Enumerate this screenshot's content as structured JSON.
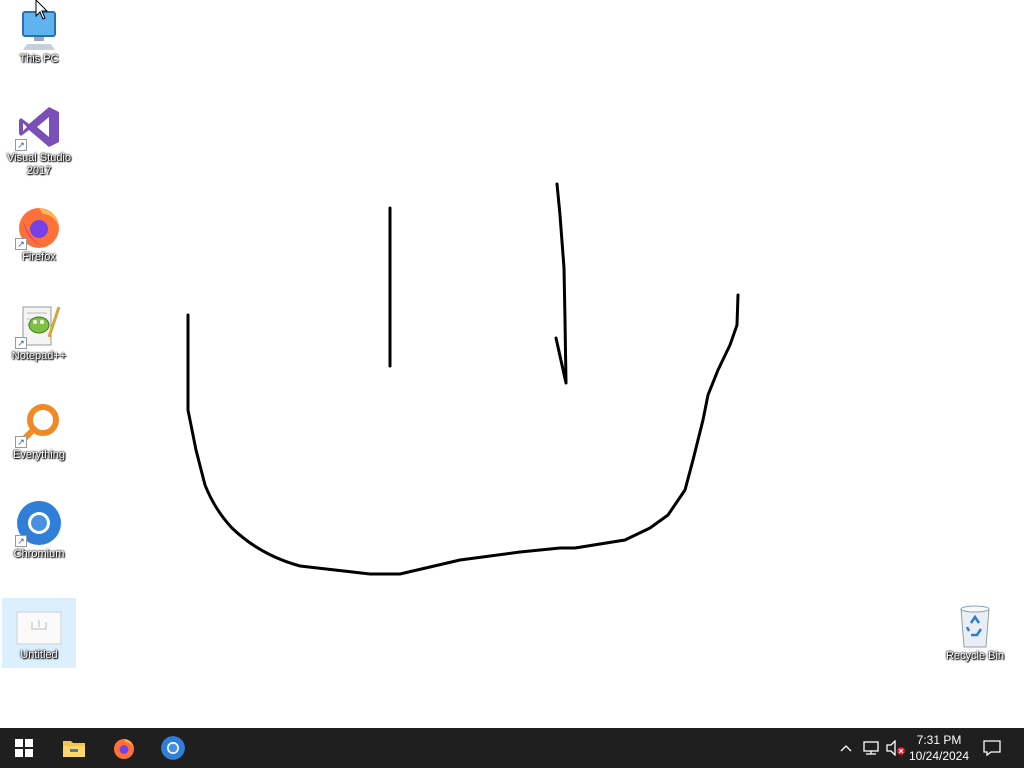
{
  "desktop": {
    "icons": [
      {
        "label": "This PC",
        "icon": "computer-icon"
      },
      {
        "label": "Visual Studio 2017",
        "icon": "visual-studio-icon"
      },
      {
        "label": "Firefox",
        "icon": "firefox-icon"
      },
      {
        "label": "Notepad++",
        "icon": "notepad-plus-plus-icon"
      },
      {
        "label": "Everything",
        "icon": "everything-search-icon"
      },
      {
        "label": "Chromium",
        "icon": "chromium-icon"
      },
      {
        "label": "Untitled",
        "icon": "blank-document-icon"
      }
    ],
    "recycle_bin": {
      "label": "Recycle Bin",
      "icon": "recycle-bin-icon"
    }
  },
  "taskbar": {
    "pinned": [
      {
        "name": "start-button",
        "icon": "windows-logo-icon"
      },
      {
        "name": "file-explorer-button",
        "icon": "folder-icon"
      },
      {
        "name": "firefox-taskbar-button",
        "icon": "firefox-icon"
      },
      {
        "name": "chromium-taskbar-button",
        "icon": "chromium-icon"
      }
    ],
    "tray": {
      "time": "7:31 PM",
      "date": "10/24/2024"
    }
  },
  "colors": {
    "taskbar": "#1f1f1f",
    "desktop_background": "#ffffff",
    "drawing_stroke": "#000000",
    "selection": "#cce8ff"
  }
}
